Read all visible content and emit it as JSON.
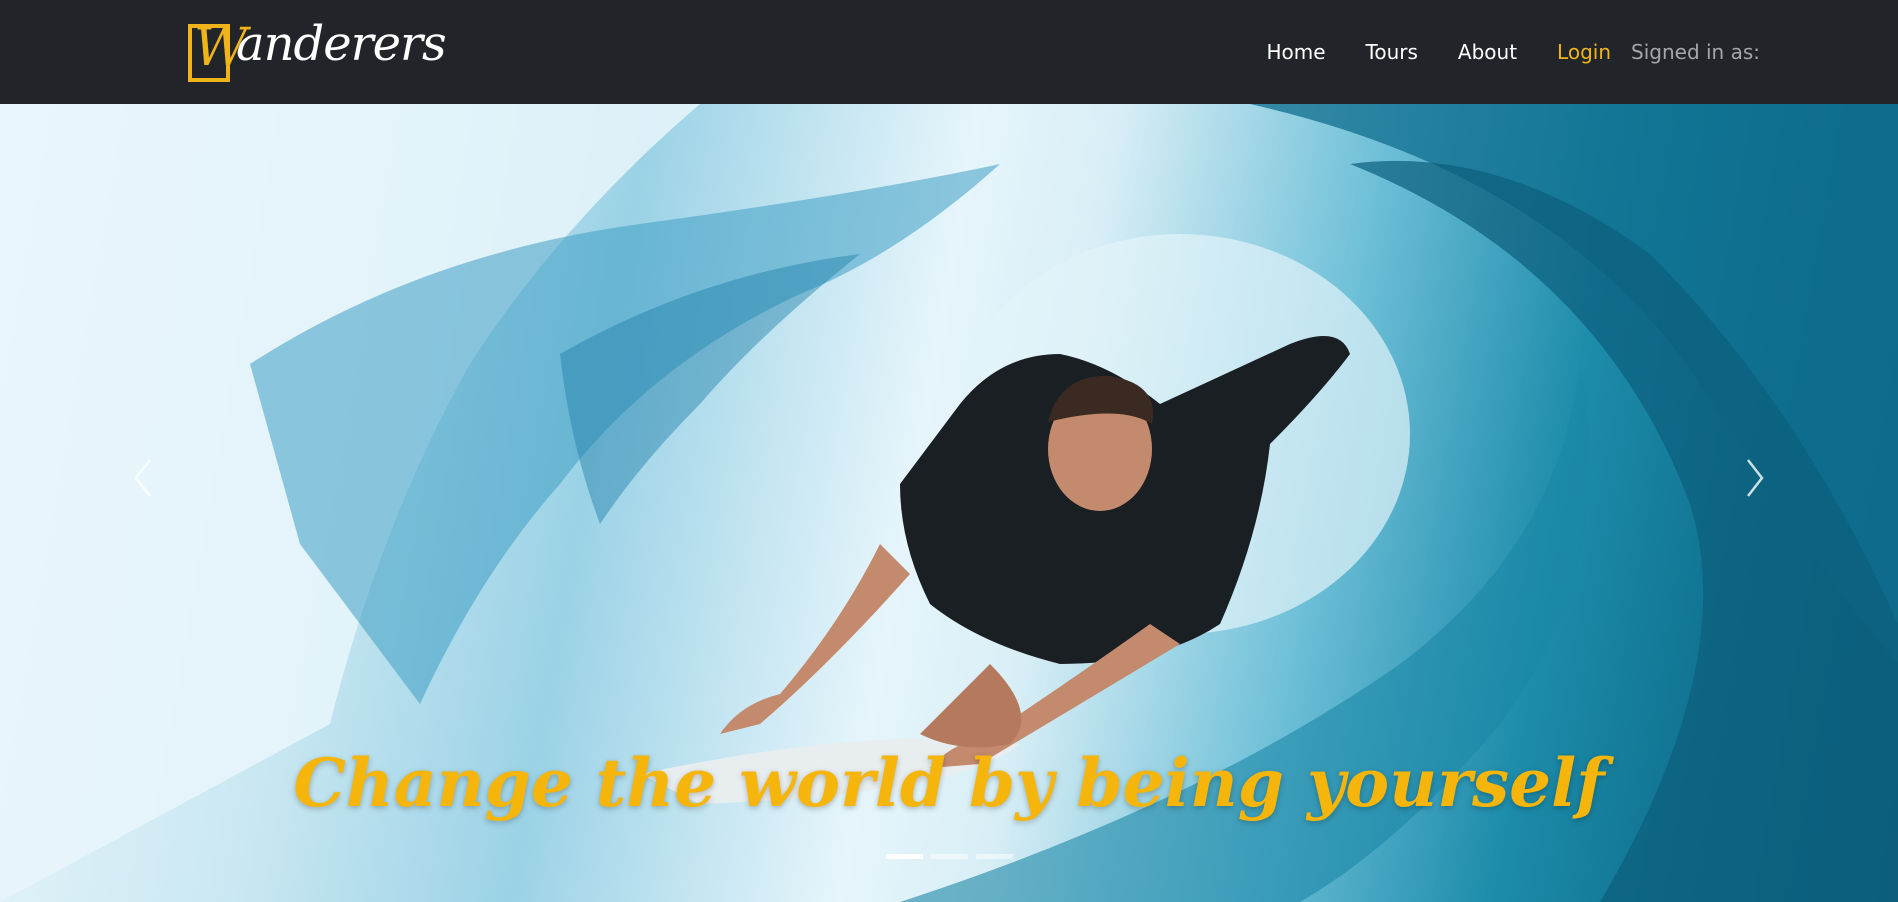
{
  "brand": {
    "first_letter": "W",
    "rest": "anderers"
  },
  "nav": {
    "home": "Home",
    "tours": "Tours",
    "about": "About",
    "login": "Login",
    "signed_in": "Signed in as:"
  },
  "carousel": {
    "caption": "Change the world by being yourself",
    "slide_count": 3,
    "active_index": 0,
    "prev_icon": "chevron-left-icon",
    "next_icon": "chevron-right-icon"
  },
  "colors": {
    "accent": "#f0b41a",
    "navbar": "#212429"
  }
}
